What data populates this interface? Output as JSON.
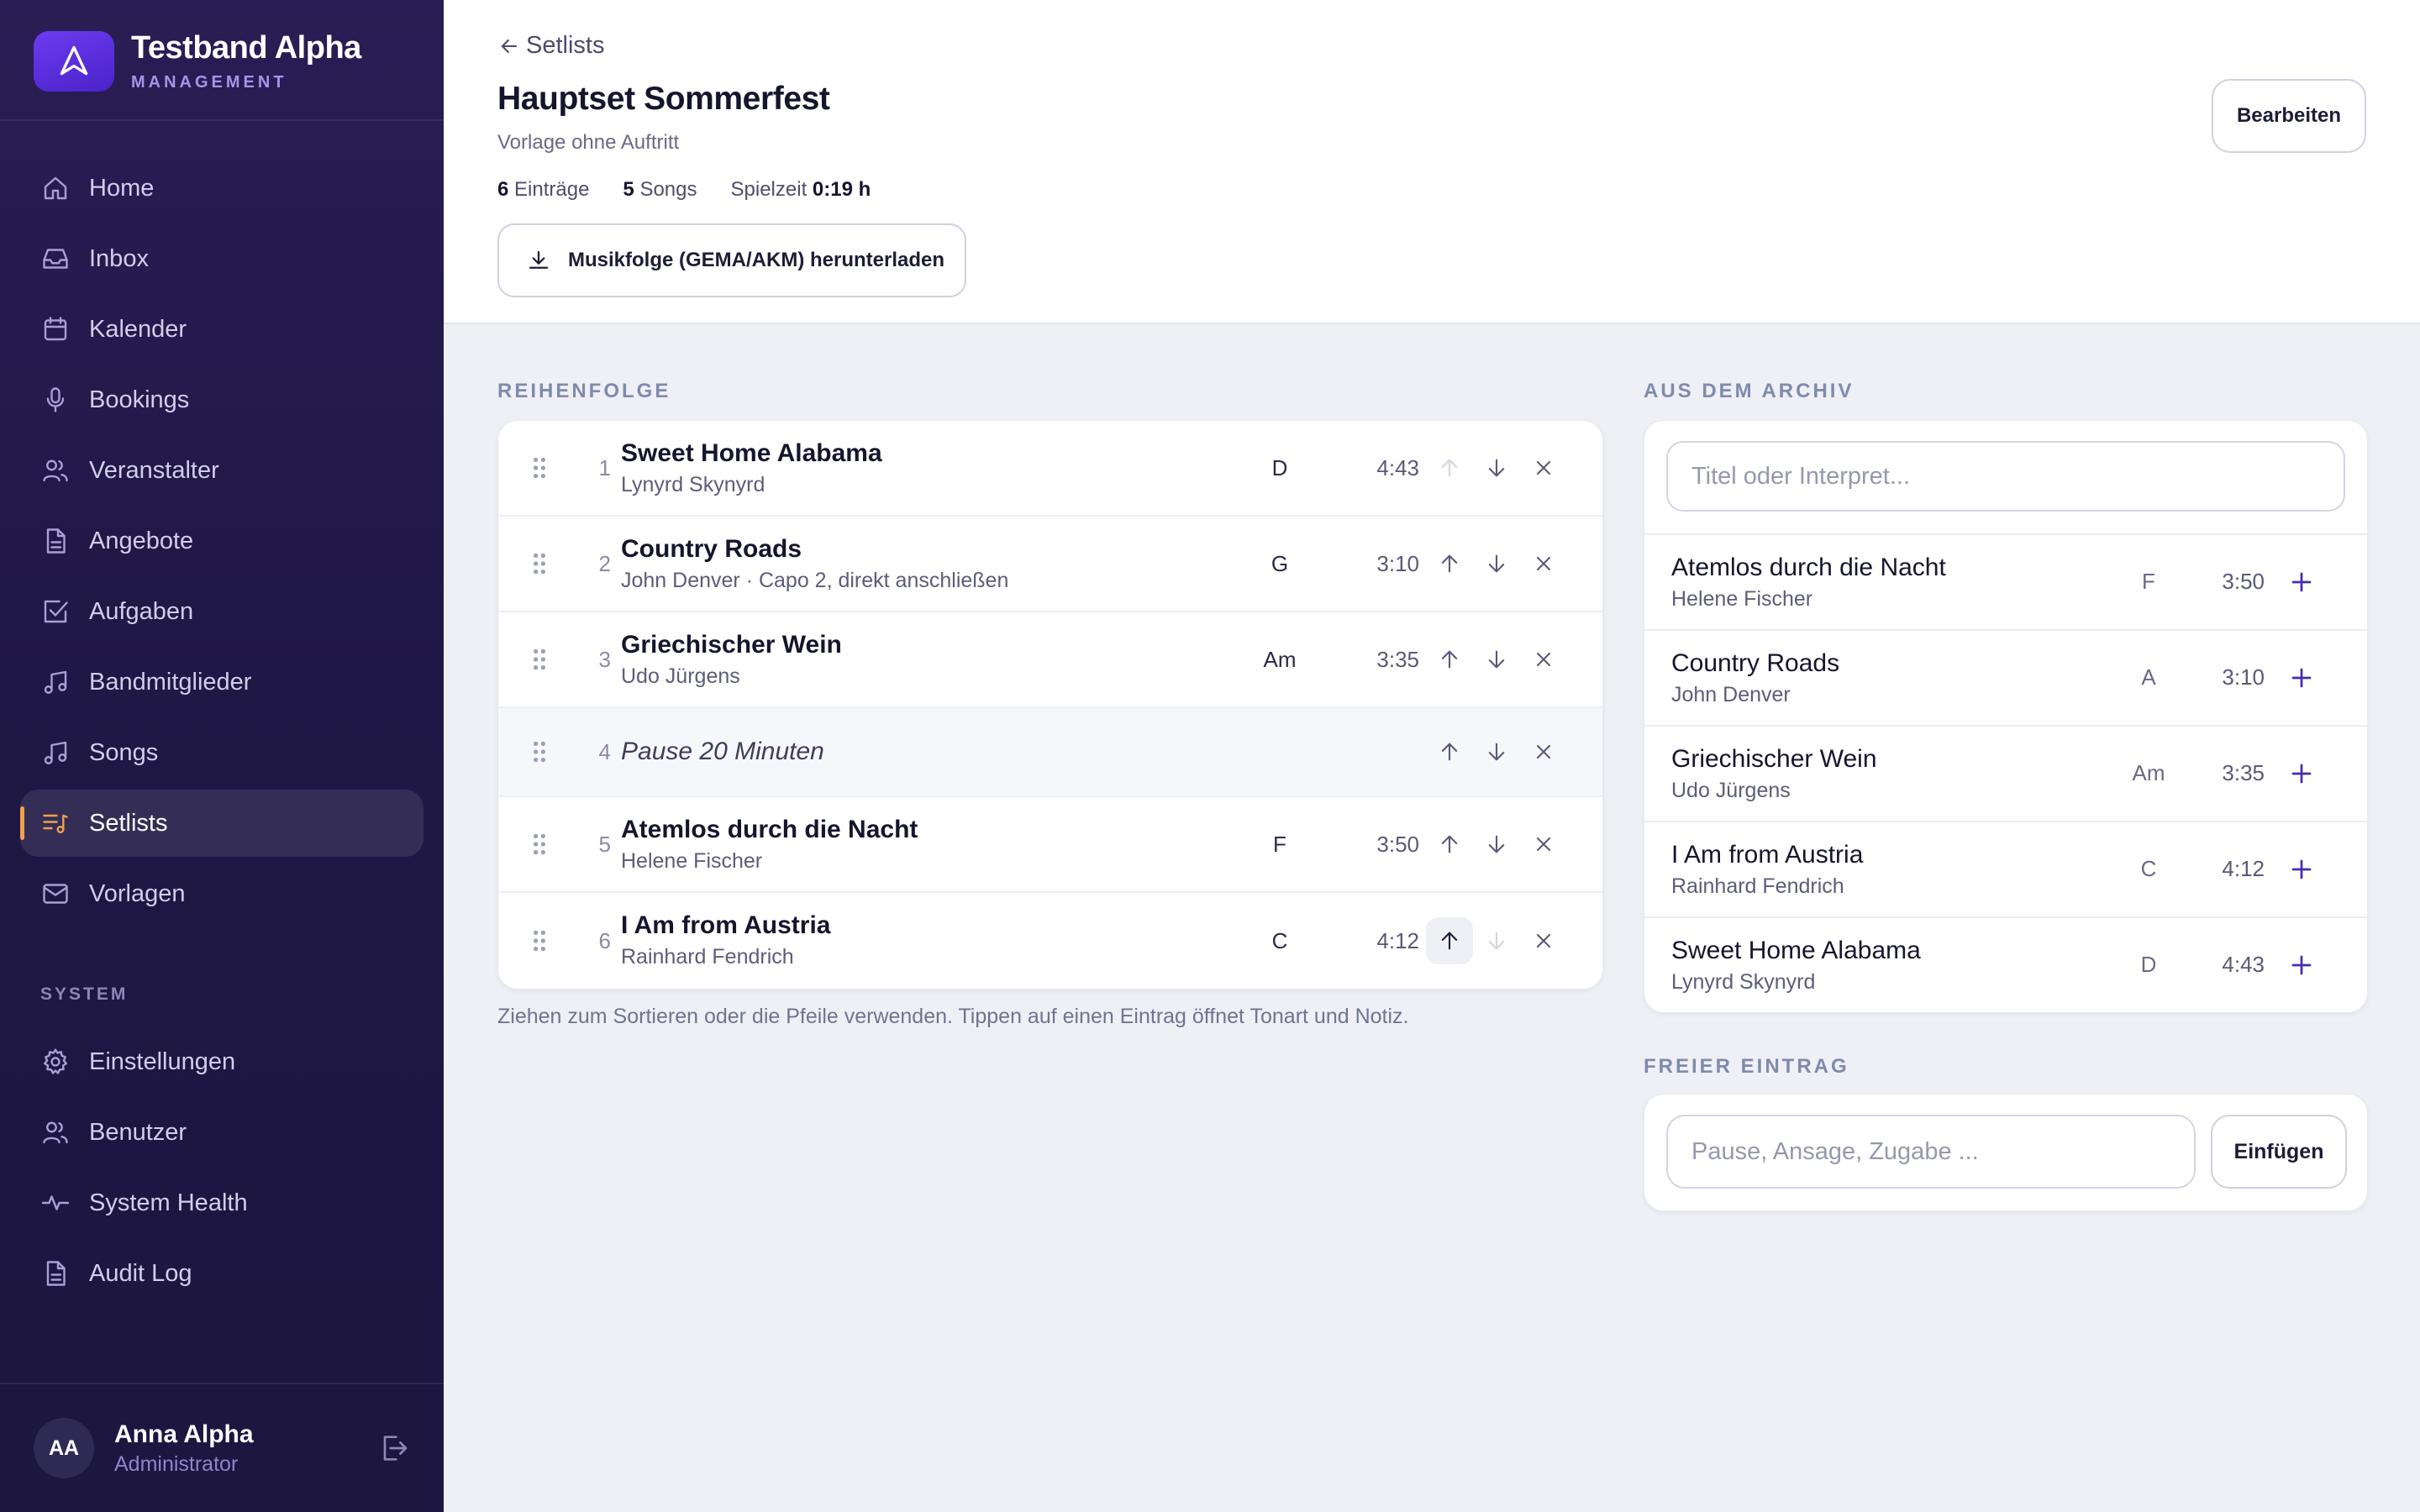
{
  "brand": {
    "title": "Testband Alpha",
    "subtitle": "MANAGEMENT"
  },
  "nav": {
    "items": [
      {
        "label": "Home",
        "icon": "home-icon"
      },
      {
        "label": "Inbox",
        "icon": "inbox-icon"
      },
      {
        "label": "Kalender",
        "icon": "calendar-icon"
      },
      {
        "label": "Bookings",
        "icon": "microphone-icon"
      },
      {
        "label": "Veranstalter",
        "icon": "users-icon"
      },
      {
        "label": "Angebote",
        "icon": "document-icon"
      },
      {
        "label": "Aufgaben",
        "icon": "checkbox-icon"
      },
      {
        "label": "Bandmitglieder",
        "icon": "music-note-icon"
      },
      {
        "label": "Songs",
        "icon": "music-note-icon"
      },
      {
        "label": "Setlists",
        "icon": "setlist-icon",
        "active": true
      },
      {
        "label": "Vorlagen",
        "icon": "mail-icon"
      }
    ],
    "system_label": "SYSTEM",
    "system_items": [
      {
        "label": "Einstellungen",
        "icon": "gear-icon"
      },
      {
        "label": "Benutzer",
        "icon": "users-icon"
      },
      {
        "label": "System Health",
        "icon": "pulse-icon"
      },
      {
        "label": "Audit Log",
        "icon": "document-icon"
      }
    ]
  },
  "user": {
    "initials": "AA",
    "name": "Anna Alpha",
    "role": "Administrator"
  },
  "header": {
    "back_label": "Setlists",
    "title": "Hauptset Sommerfest",
    "subtitle": "Vorlage ohne Auftritt",
    "stats": {
      "entries_count": "6",
      "entries_label": "Einträge",
      "songs_count": "5",
      "songs_label": "Songs",
      "playtime_label": "Spielzeit",
      "playtime_value": "0:19 h"
    },
    "download_label": "Musikfolge (GEMA/AKM) herunterladen",
    "edit_label": "Bearbeiten"
  },
  "order": {
    "label": "REIHENFOLGE",
    "rows": [
      {
        "num": "1",
        "title": "Sweet Home Alabama",
        "sub": "Lynyrd Skynyrd",
        "key": "D",
        "duration": "4:43"
      },
      {
        "num": "2",
        "title": "Country Roads",
        "sub": "John Denver · Capo 2, direkt anschließen",
        "key": "G",
        "duration": "3:10"
      },
      {
        "num": "3",
        "title": "Griechischer Wein",
        "sub": "Udo Jürgens",
        "key": "Am",
        "duration": "3:35"
      },
      {
        "num": "4",
        "title": "Pause 20 Minuten",
        "pause": true
      },
      {
        "num": "5",
        "title": "Atemlos durch die Nacht",
        "sub": "Helene Fischer",
        "key": "F",
        "duration": "3:50"
      },
      {
        "num": "6",
        "title": "I Am from Austria",
        "sub": "Rainhard Fendrich",
        "key": "C",
        "duration": "4:12"
      }
    ],
    "hint": "Ziehen zum Sortieren oder die Pfeile verwenden. Tippen auf einen Eintrag öffnet Tonart und Notiz."
  },
  "archive": {
    "label": "AUS DEM ARCHIV",
    "search_placeholder": "Titel oder Interpret...",
    "rows": [
      {
        "title": "Atemlos durch die Nacht",
        "sub": "Helene Fischer",
        "key": "F",
        "duration": "3:50"
      },
      {
        "title": "Country Roads",
        "sub": "John Denver",
        "key": "A",
        "duration": "3:10"
      },
      {
        "title": "Griechischer Wein",
        "sub": "Udo Jürgens",
        "key": "Am",
        "duration": "3:35"
      },
      {
        "title": "I Am from Austria",
        "sub": "Rainhard Fendrich",
        "key": "C",
        "duration": "4:12"
      },
      {
        "title": "Sweet Home Alabama",
        "sub": "Lynyrd Skynyrd",
        "key": "D",
        "duration": "4:43"
      }
    ]
  },
  "free_entry": {
    "label": "FREIER EINTRAG",
    "placeholder": "Pause, Ansage, Zugabe ...",
    "button_label": "Einfügen"
  },
  "colors": {
    "sidebar_bg": "#1f1745",
    "accent": "#5b2fd6",
    "active_marker": "#f0a04b",
    "add_icon": "#4a2bb0"
  }
}
